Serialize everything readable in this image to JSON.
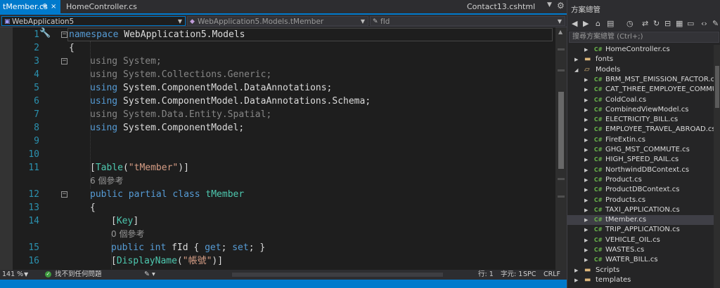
{
  "editor_tabs": {
    "active": {
      "label": "tMember.cs",
      "pin": "⊕",
      "close": "×"
    },
    "second": {
      "label": "HomeController.cs"
    },
    "third": {
      "label": "Contact13.cshtml"
    }
  },
  "navbar": {
    "project": "WebApplication5",
    "class": "WebApplication5.Models.tMember",
    "member": "fId"
  },
  "code": {
    "lines": [
      {
        "n": "1",
        "kw": "namespace",
        "rest": " WebApplication5.Models"
      },
      {
        "n": "2",
        "text": "{"
      },
      {
        "n": "3",
        "kw": "using",
        "rest": " System;",
        "dim": true
      },
      {
        "n": "4",
        "kw": "using",
        "rest": " System.Collections.Generic;",
        "dim": true
      },
      {
        "n": "5",
        "kw": "using",
        "rest": " System.ComponentModel.DataAnnotations;"
      },
      {
        "n": "6",
        "kw": "using",
        "rest": " System.ComponentModel.DataAnnotations.Schema;"
      },
      {
        "n": "7",
        "kw": "using",
        "rest": " System.Data.Entity.Spatial;",
        "dim": true
      },
      {
        "n": "8",
        "kw": "using",
        "rest": " System.ComponentModel;"
      },
      {
        "n": "9",
        "text": ""
      },
      {
        "n": "10",
        "text": ""
      },
      {
        "n": "11",
        "attr_open": "[",
        "attr_name": "Table",
        "attr_paren": "(",
        "attr_str": "\"tMember\"",
        "attr_close": ")]"
      },
      {
        "lens": "6 個參考"
      },
      {
        "n": "12",
        "kw1": "public",
        "kw2": " partial",
        "kw3": " class",
        "type": " tMember"
      },
      {
        "n": "13",
        "text": "{"
      },
      {
        "n": "14",
        "attr_open": "[",
        "attr_name": "Key",
        "attr_close": "]"
      },
      {
        "lens": "0 個參考"
      },
      {
        "n": "15",
        "kw1": "public",
        "kw2": " int",
        "name": " fId",
        "brace_o": " {",
        "get": " get",
        "semi1": ";",
        "set": " set",
        "semi2": ";",
        "brace_c": " }"
      },
      {
        "n": "16",
        "attr_open": "[",
        "attr_name": "DisplayName",
        "attr_paren": "(",
        "attr_str": "\"帳號\"",
        "attr_close": ")]"
      }
    ]
  },
  "bottombar": {
    "zoom": "141 %",
    "issues": "找不到任何問題",
    "line": "行: 1",
    "col": "字元: 1",
    "spc": "SPC",
    "crlf": "CRLF"
  },
  "solution_explorer": {
    "title": "方案總管",
    "search_placeholder": "搜尋方案總管 (Ctrl+;)",
    "items": [
      {
        "label": "HomeController.cs",
        "kind": "cs",
        "level": 1
      },
      {
        "label": "fonts",
        "kind": "folder",
        "level": 0
      },
      {
        "label": "Models",
        "kind": "folder-open",
        "level": 0
      },
      {
        "label": "BRM_MST_EMISSION_FACTOR.cs",
        "kind": "cs",
        "level": 1
      },
      {
        "label": "CAT_THREE_EMPLOYEE_COMMUTE.cs",
        "kind": "cs",
        "level": 1
      },
      {
        "label": "ColdCoal.cs",
        "kind": "cs",
        "level": 1
      },
      {
        "label": "CombinedViewModel.cs",
        "kind": "cs",
        "level": 1
      },
      {
        "label": "ELECTRICITY_BILL.cs",
        "kind": "cs",
        "level": 1
      },
      {
        "label": "EMPLOYEE_TRAVEL_ABROAD.cs",
        "kind": "cs",
        "level": 1
      },
      {
        "label": "FireExtin.cs",
        "kind": "cs",
        "level": 1
      },
      {
        "label": "GHG_MST_COMMUTE.cs",
        "kind": "cs",
        "level": 1
      },
      {
        "label": "HIGH_SPEED_RAIL.cs",
        "kind": "cs",
        "level": 1
      },
      {
        "label": "NorthwindDBContext.cs",
        "kind": "cs",
        "level": 1
      },
      {
        "label": "Product.cs",
        "kind": "cs",
        "level": 1
      },
      {
        "label": "ProductDBContext.cs",
        "kind": "cs",
        "level": 1
      },
      {
        "label": "Products.cs",
        "kind": "cs",
        "level": 1
      },
      {
        "label": "TAXI_APPLICATION.cs",
        "kind": "cs",
        "level": 1
      },
      {
        "label": "tMember.cs",
        "kind": "cs",
        "level": 1,
        "selected": true
      },
      {
        "label": "TRIP_APPLICATION.cs",
        "kind": "cs",
        "level": 1
      },
      {
        "label": "VEHICLE_OIL.cs",
        "kind": "cs",
        "level": 1
      },
      {
        "label": "WASTES.cs",
        "kind": "cs",
        "level": 1
      },
      {
        "label": "WATER_BILL.cs",
        "kind": "cs",
        "level": 1
      },
      {
        "label": "Scripts",
        "kind": "folder",
        "level": 0
      },
      {
        "label": "templates",
        "kind": "folder",
        "level": 0
      }
    ]
  },
  "colors": {
    "accent": "#007acc",
    "keyword": "#569cd6",
    "type": "#4ec9b0",
    "string": "#d69d85",
    "line_number": "#2b91af"
  }
}
